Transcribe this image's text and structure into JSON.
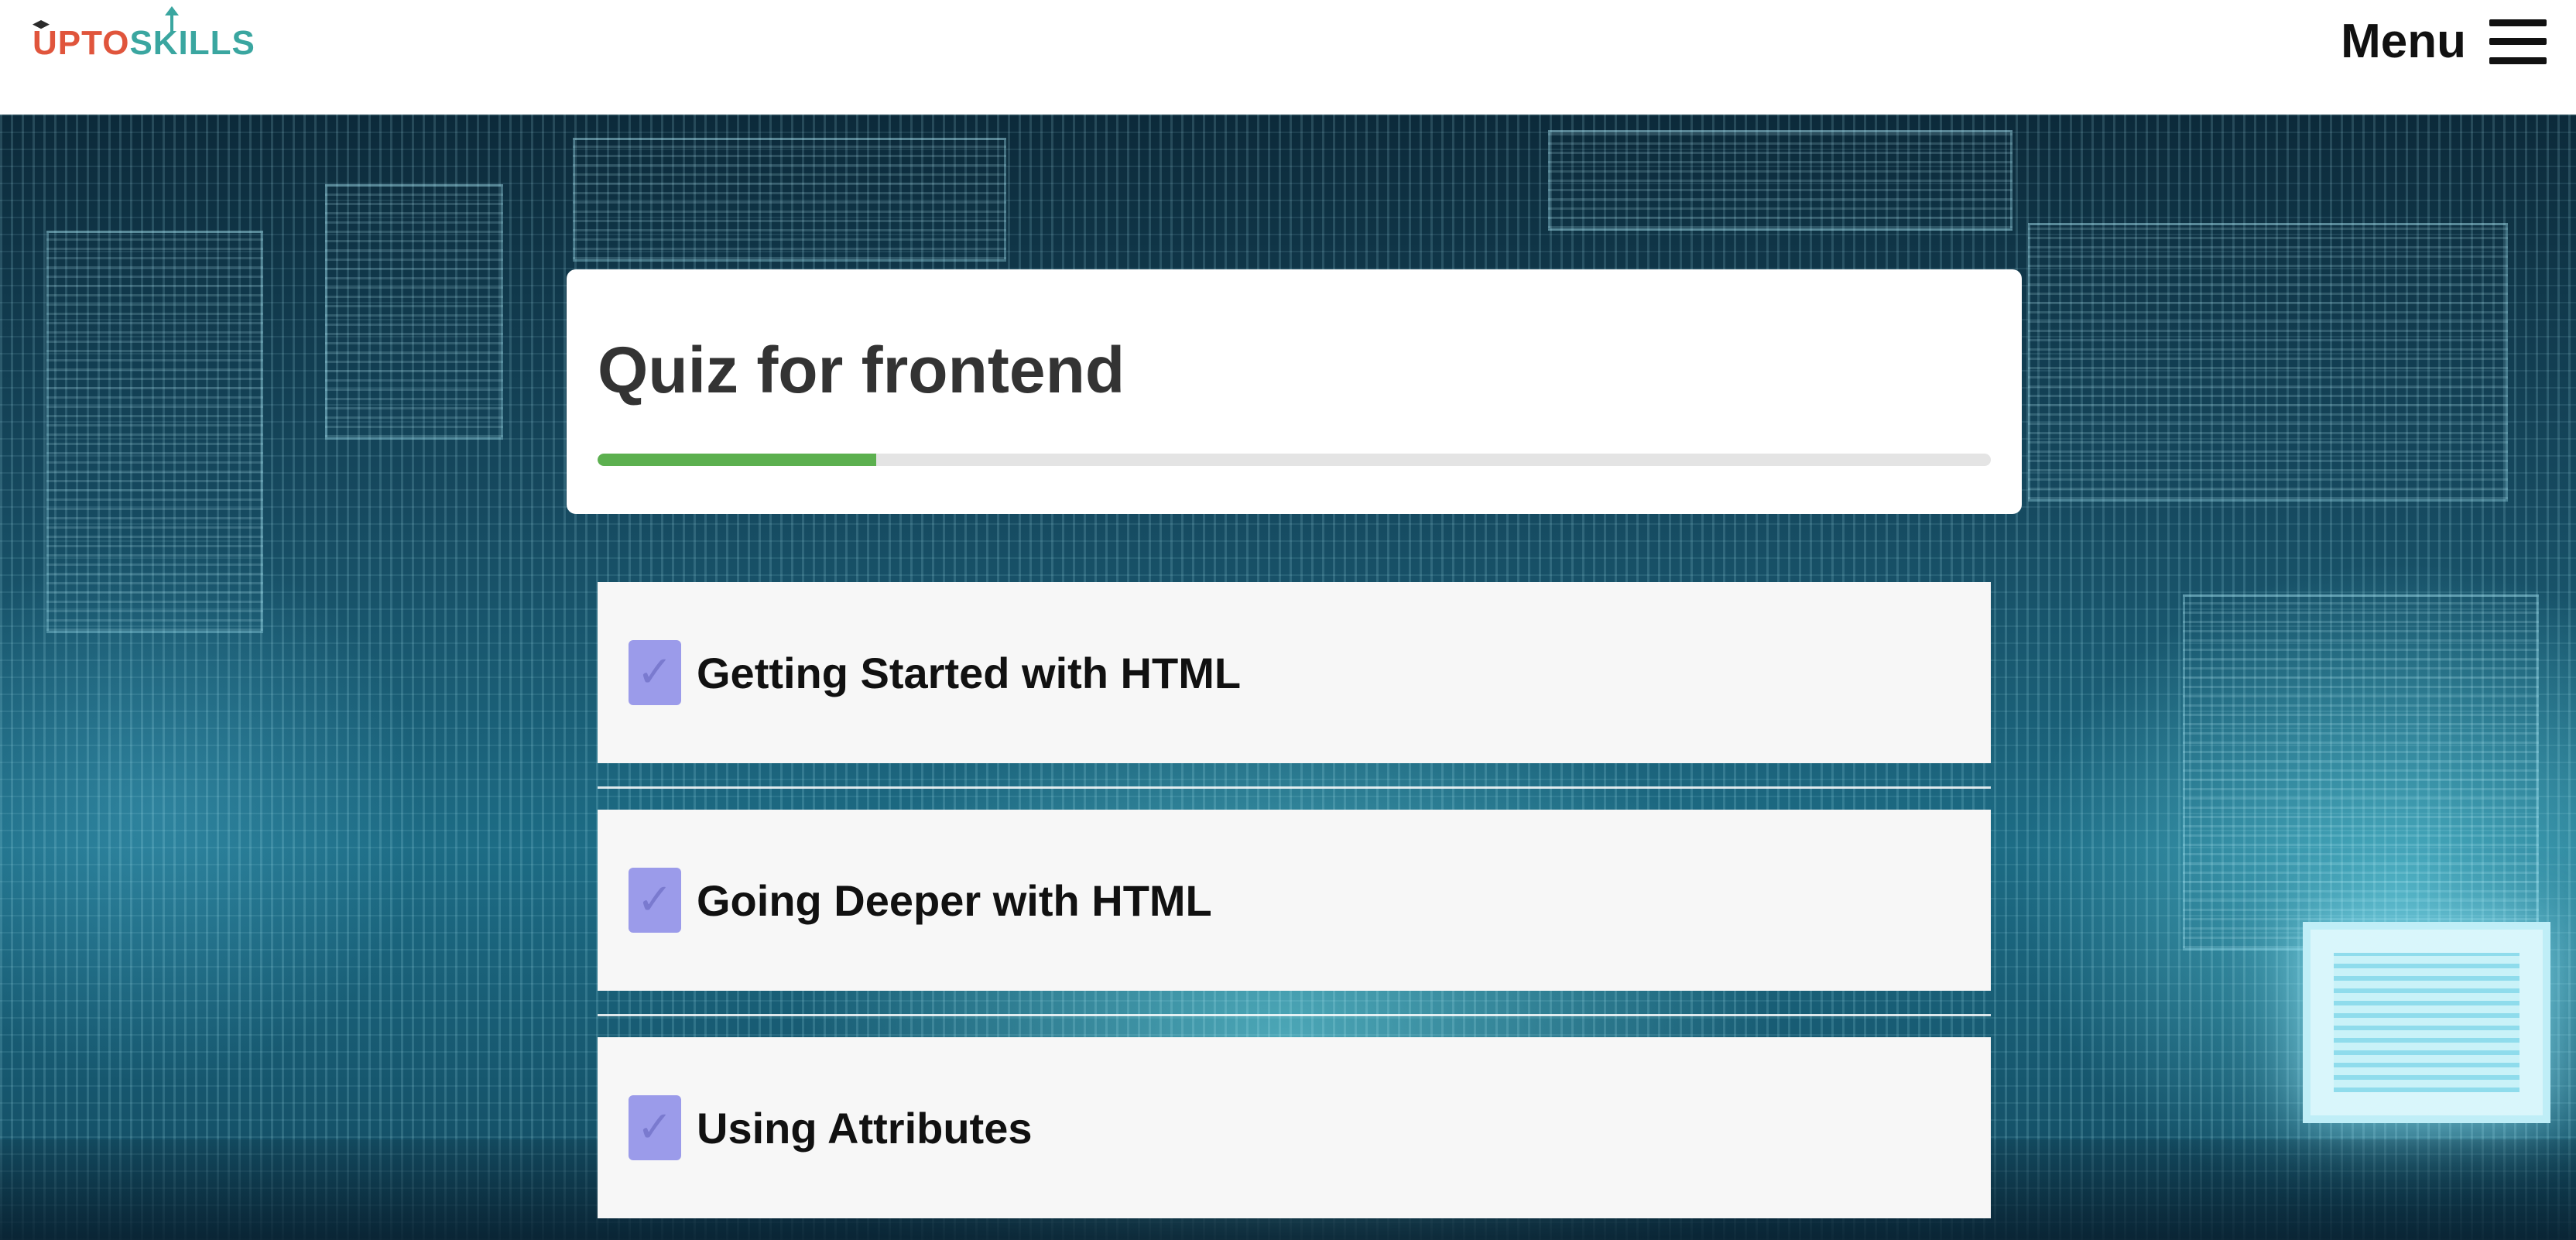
{
  "header": {
    "logo": {
      "part1": "UPTO",
      "part2": "SKILLS"
    },
    "menu_label": "Menu"
  },
  "quiz": {
    "title": "Quiz for frontend",
    "progress_percent": 20
  },
  "topics": [
    {
      "label": "Getting Started with HTML",
      "checked": true
    },
    {
      "label": "Going Deeper with HTML",
      "checked": true
    },
    {
      "label": "Using Attributes",
      "checked": true
    }
  ],
  "colors": {
    "progress_fill": "#5cb04f",
    "progress_track": "#e4e4e4",
    "checkbox": "#9b9bea",
    "logo_orange": "#e0553c",
    "logo_teal": "#3aa6a0"
  },
  "icons": {
    "menu": "hamburger-icon",
    "checkbox": "check-icon"
  }
}
